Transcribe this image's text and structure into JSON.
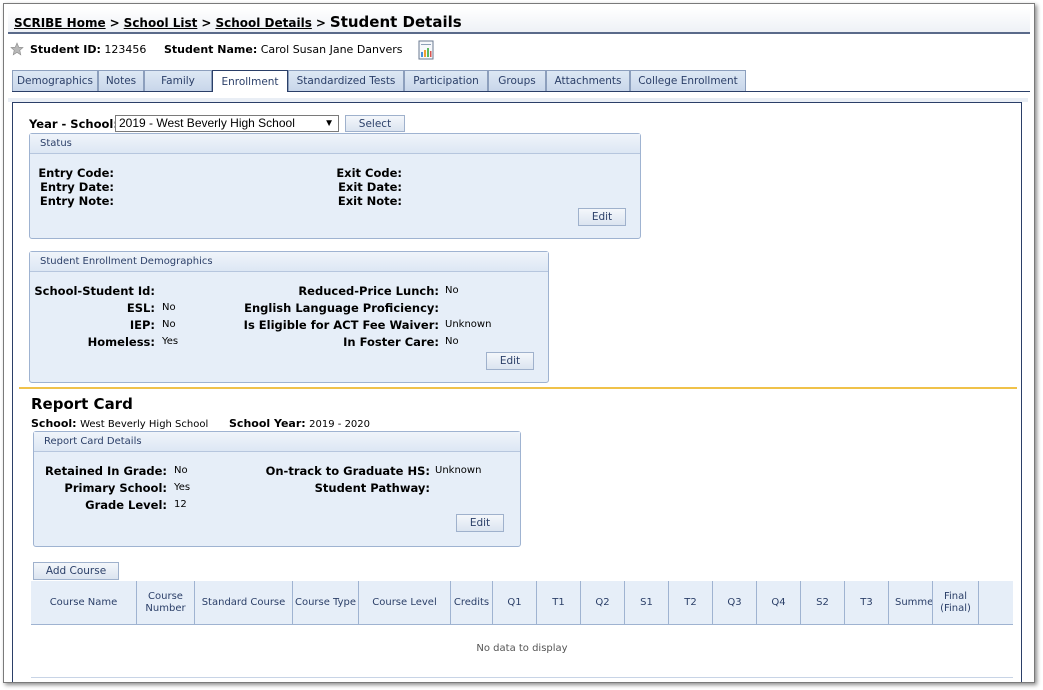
{
  "breadcrumb": {
    "home": "SCRIBE Home",
    "school_list": "School List",
    "school_details": "School Details",
    "separator": ">",
    "current": "Student Details"
  },
  "student": {
    "id_label": "Student ID:",
    "id_value": "123456",
    "name_label": "Student Name:",
    "name_value": "Carol Susan Jane Danvers"
  },
  "tabs": [
    {
      "label": "Demographics",
      "active": false
    },
    {
      "label": "Notes",
      "active": false
    },
    {
      "label": "Family",
      "active": false
    },
    {
      "label": "Enrollment",
      "active": true
    },
    {
      "label": "Standardized Tests",
      "active": false
    },
    {
      "label": "Participation",
      "active": false
    },
    {
      "label": "Groups",
      "active": false
    },
    {
      "label": "Attachments",
      "active": false
    },
    {
      "label": "College Enrollment",
      "active": false
    }
  ],
  "year_school": {
    "label": "Year - School:",
    "selected": "2019 - West Beverly High School",
    "select_button": "Select"
  },
  "status_panel": {
    "title": "Status",
    "entry_code": "Entry Code:",
    "entry_date": "Entry Date:",
    "entry_note": "Entry Note:",
    "exit_code": "Exit Code:",
    "exit_date": "Exit Date:",
    "exit_note": "Exit Note:",
    "edit": "Edit"
  },
  "demographics_panel": {
    "title": "Student Enrollment Demographics",
    "school_student_id": "School-Student Id:",
    "esl_label": "ESL:",
    "esl_value": "No",
    "iep_label": "IEP:",
    "iep_value": "No",
    "homeless_label": "Homeless:",
    "homeless_value": "Yes",
    "rpl_label": "Reduced-Price Lunch:",
    "rpl_value": "No",
    "elp_label": "English Language Proficiency:",
    "act_label": "Is Eligible for ACT Fee Waiver:",
    "act_value": "Unknown",
    "foster_label": "In Foster Care:",
    "foster_value": "No",
    "edit": "Edit"
  },
  "report_card": {
    "title": "Report Card",
    "school_label": "School:",
    "school_value": "West Beverly High School",
    "year_label": "School Year:",
    "year_value": "2019 - 2020",
    "details_title": "Report Card Details",
    "retained_label": "Retained In Grade:",
    "retained_value": "No",
    "primary_label": "Primary School:",
    "primary_value": "Yes",
    "grade_label": "Grade Level:",
    "grade_value": "12",
    "ontrack_label": "On-track to Graduate HS:",
    "ontrack_value": "Unknown",
    "pathway_label": "Student Pathway:",
    "edit": "Edit",
    "add_course": "Add Course"
  },
  "courses_table": {
    "columns": [
      "Course Name",
      "Course Number",
      "Standard Course",
      "Course Type",
      "Course Level",
      "Credits",
      "Q1",
      "T1",
      "Q2",
      "S1",
      "T2",
      "Q3",
      "Q4",
      "S2",
      "T3",
      "Summe",
      "Final (Final)"
    ],
    "empty_text": "No data to display"
  },
  "colors": {
    "accent": "#2b3f68",
    "panel_bg": "#e6eef8",
    "divider": "#f0c24a"
  }
}
